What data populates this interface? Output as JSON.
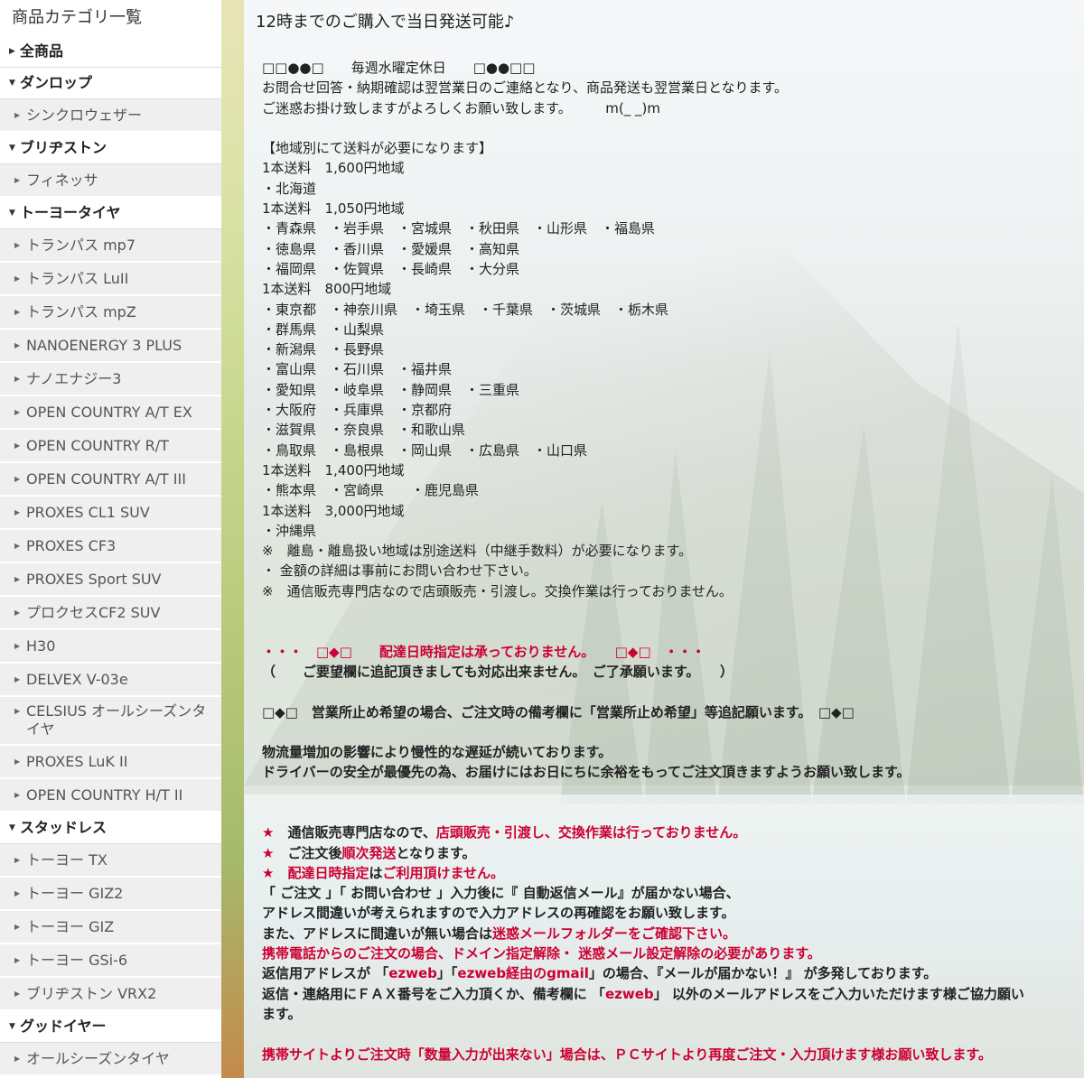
{
  "sidebar": {
    "title": "商品カテゴリ一覧",
    "items": [
      {
        "type": "cat",
        "label": "全商品"
      },
      {
        "type": "cat",
        "label": "ダンロップ",
        "open": true
      },
      {
        "type": "sub",
        "label": "シンクロウェザー"
      },
      {
        "type": "cat",
        "label": "ブリヂストン",
        "open": true
      },
      {
        "type": "sub",
        "label": "フィネッサ"
      },
      {
        "type": "cat",
        "label": "トーヨータイヤ",
        "open": true
      },
      {
        "type": "sub",
        "label": "トランパス mp7"
      },
      {
        "type": "sub",
        "label": "トランパス LuII"
      },
      {
        "type": "sub",
        "label": "トランパス mpZ"
      },
      {
        "type": "sub",
        "label": "NANOENERGY 3 PLUS"
      },
      {
        "type": "sub",
        "label": "ナノエナジー3"
      },
      {
        "type": "sub",
        "label": "OPEN COUNTRY A/T EX"
      },
      {
        "type": "sub",
        "label": "OPEN COUNTRY R/T"
      },
      {
        "type": "sub",
        "label": "OPEN COUNTRY A/T III"
      },
      {
        "type": "sub",
        "label": "PROXES CL1 SUV"
      },
      {
        "type": "sub",
        "label": "PROXES CF3"
      },
      {
        "type": "sub",
        "label": "PROXES Sport SUV"
      },
      {
        "type": "sub",
        "label": "プロクセスCF2 SUV"
      },
      {
        "type": "sub",
        "label": "H30"
      },
      {
        "type": "sub",
        "label": "DELVEX V-03e"
      },
      {
        "type": "sub",
        "label": "CELSIUS オールシーズンタイヤ",
        "tall": true
      },
      {
        "type": "sub",
        "label": "PROXES LuK II"
      },
      {
        "type": "sub",
        "label": "OPEN COUNTRY H/T II"
      },
      {
        "type": "cat",
        "label": "スタッドレス",
        "open": true
      },
      {
        "type": "sub",
        "label": "トーヨー TX"
      },
      {
        "type": "sub",
        "label": "トーヨー GIZ2"
      },
      {
        "type": "sub",
        "label": "トーヨー GIZ"
      },
      {
        "type": "sub",
        "label": "トーヨー GSi-6"
      },
      {
        "type": "sub",
        "label": "ブリヂストン VRX2"
      },
      {
        "type": "cat",
        "label": "グッドイヤー",
        "open": true
      },
      {
        "type": "sub",
        "label": "オールシーズンタイヤ"
      }
    ]
  },
  "main": {
    "heading": "12時までのご購入で当日発送可能♪",
    "lines": [
      {
        "segs": [
          {
            "t": "□□●●□　　毎週水曜定休日　　□●●□□"
          }
        ]
      },
      {
        "segs": [
          {
            "t": "お問合せ回答・納期確認は翌営業日のご連絡となり、商品発送も翌営業日となります。"
          }
        ]
      },
      {
        "segs": [
          {
            "t": "ご迷惑お掛け致しますがよろしくお願い致します。　　　m(_ _)m"
          }
        ]
      },
      {
        "blank": true
      },
      {
        "segs": [
          {
            "t": "【地域別にて送料が必要になります】"
          }
        ]
      },
      {
        "segs": [
          {
            "t": "1本送料　1,600円地域"
          }
        ]
      },
      {
        "segs": [
          {
            "t": "・北海道"
          }
        ]
      },
      {
        "segs": [
          {
            "t": "1本送料　1,050円地域"
          }
        ]
      },
      {
        "segs": [
          {
            "t": "・青森県　・岩手県　・宮城県　・秋田県　・山形県　・福島県"
          }
        ]
      },
      {
        "segs": [
          {
            "t": "・徳島県　・香川県　・愛媛県　・高知県"
          }
        ]
      },
      {
        "segs": [
          {
            "t": "・福岡県　・佐賀県　・長崎県　・大分県"
          }
        ]
      },
      {
        "segs": [
          {
            "t": "1本送料　800円地域"
          }
        ]
      },
      {
        "segs": [
          {
            "t": "・東京都　・神奈川県　・埼玉県　・千葉県　・茨城県　・栃木県"
          }
        ]
      },
      {
        "segs": [
          {
            "t": "・群馬県　・山梨県"
          }
        ]
      },
      {
        "segs": [
          {
            "t": "・新潟県　・長野県"
          }
        ]
      },
      {
        "segs": [
          {
            "t": "・富山県　・石川県　・福井県"
          }
        ]
      },
      {
        "segs": [
          {
            "t": "・愛知県　・岐阜県　・静岡県　・三重県"
          }
        ]
      },
      {
        "segs": [
          {
            "t": "・大阪府　・兵庫県　・京都府"
          }
        ]
      },
      {
        "segs": [
          {
            "t": "・滋賀県　・奈良県　・和歌山県"
          }
        ]
      },
      {
        "segs": [
          {
            "t": "・鳥取県　・島根県　・岡山県　・広島県　・山口県"
          }
        ]
      },
      {
        "segs": [
          {
            "t": "1本送料　1,400円地域"
          }
        ]
      },
      {
        "segs": [
          {
            "t": "・熊本県　・宮崎県　　・鹿児島県"
          }
        ]
      },
      {
        "segs": [
          {
            "t": "1本送料　3,000円地域"
          }
        ]
      },
      {
        "segs": [
          {
            "t": "・沖縄県"
          }
        ]
      },
      {
        "segs": [
          {
            "t": "※　離島・離島扱い地域は別途送料（中継手数料）が必要になります。"
          }
        ]
      },
      {
        "segs": [
          {
            "t": "・ 金額の詳細は事前にお問い合わせ下さい。"
          }
        ]
      },
      {
        "segs": [
          {
            "t": "※　通信販売専門店なので店頭販売・引渡し。交換作業は行っておりません。"
          }
        ]
      },
      {
        "blank": true
      },
      {
        "blank": true
      },
      {
        "segs": [
          {
            "t": "・・・　□◆□　　配達日時指定は承っておりません。　　□◆□　・・・",
            "c": "red",
            "b": true
          }
        ]
      },
      {
        "segs": [
          {
            "t": "（　　ご要望欄に追記頂きましても対応出来ません。　ご了承願います。　　）",
            "b": true
          }
        ]
      },
      {
        "blank": true
      },
      {
        "segs": [
          {
            "t": "□◆□　営業所止め希望の場合、ご注文時の備考欄に「営業所止め希望」等追記願います。　□◆□",
            "b": true
          }
        ]
      },
      {
        "blank": true
      },
      {
        "segs": [
          {
            "t": "物流量増加の影響により慢性的な遅延が続いております。",
            "b": true
          }
        ]
      },
      {
        "segs": [
          {
            "t": "ドライバーの安全が最優先の為、お届けにはお日にちに余裕をもってご注文頂きますようお願い致します。",
            "b": true
          }
        ]
      },
      {
        "blank": true
      },
      {
        "blank": true
      },
      {
        "segs": [
          {
            "t": "★　",
            "c": "red",
            "b": true
          },
          {
            "t": "通信販売専門店なので、",
            "b": true
          },
          {
            "t": "店頭販売・引渡し、交換作業は行っておりません。",
            "c": "red",
            "b": true
          }
        ]
      },
      {
        "segs": [
          {
            "t": "★　",
            "c": "red",
            "b": true
          },
          {
            "t": "ご注文後",
            "b": true
          },
          {
            "t": "順次発送",
            "c": "red",
            "b": true
          },
          {
            "t": "となります。",
            "b": true
          }
        ]
      },
      {
        "segs": [
          {
            "t": "★　",
            "c": "red",
            "b": true
          },
          {
            "t": "配達日時指定",
            "c": "red",
            "b": true
          },
          {
            "t": "は",
            "b": true
          },
          {
            "t": "ご利用頂けません。",
            "c": "red",
            "b": true
          }
        ]
      },
      {
        "segs": [
          {
            "t": "「 ご注文 」「 お問い合わせ 」入力後に『 自動返信メール』が届かない場合、",
            "b": true
          }
        ]
      },
      {
        "segs": [
          {
            "t": "アドレス間違いが考えられますので入力アドレスの再確認をお願い致します。",
            "b": true
          }
        ]
      },
      {
        "segs": [
          {
            "t": "また、アドレスに間違いが無い場合は",
            "b": true
          },
          {
            "t": "迷惑メールフォルダーをご確認下さい。",
            "c": "red",
            "b": true
          }
        ]
      },
      {
        "segs": [
          {
            "t": "携帯電話からのご注文の場合、ドメイン指定解除・ 迷惑メール設定解除の必要があります。",
            "c": "red",
            "b": true
          }
        ]
      },
      {
        "segs": [
          {
            "t": "返信用アドレスが 「",
            "b": true
          },
          {
            "t": "ezweb",
            "c": "red",
            "b": true
          },
          {
            "t": "」「",
            "b": true
          },
          {
            "t": "ezweb経由のgmail",
            "c": "red",
            "b": true
          },
          {
            "t": "」の場合、『メールが届かない！』 が多発しております。",
            "b": true
          }
        ]
      },
      {
        "segs": [
          {
            "t": "返信・連絡用にＦＡＸ番号をご入力頂くか、備考欄に 「",
            "b": true
          },
          {
            "t": "ezweb",
            "c": "red",
            "b": true
          },
          {
            "t": "」 以外のメールアドレスをご入力いただけます様ご協力願い",
            "b": true
          }
        ]
      },
      {
        "segs": [
          {
            "t": "ます。",
            "b": true
          }
        ]
      },
      {
        "blank": true
      },
      {
        "segs": [
          {
            "t": "携帯サイトよりご注文時「数量入力が出来ない」場合は、ＰＣサイトより再度ご注文・入力頂けます様お願い致します。",
            "c": "red",
            "b": true
          }
        ]
      }
    ]
  }
}
